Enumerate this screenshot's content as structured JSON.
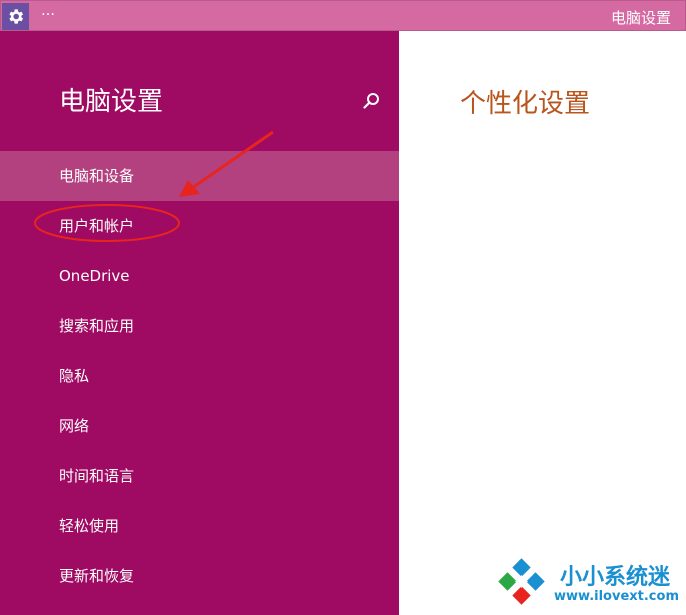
{
  "titlebar": {
    "dots": "…",
    "title": "电脑设置"
  },
  "sidebar": {
    "title": "电脑设置",
    "items": [
      {
        "label": "电脑和设备",
        "selected": true
      },
      {
        "label": "用户和帐户"
      },
      {
        "label": "OneDrive"
      },
      {
        "label": "搜索和应用"
      },
      {
        "label": "隐私"
      },
      {
        "label": "网络"
      },
      {
        "label": "时间和语言"
      },
      {
        "label": "轻松使用"
      },
      {
        "label": "更新和恢复"
      }
    ]
  },
  "main": {
    "title": "个性化设置"
  },
  "watermark": {
    "name": "小小系统迷",
    "url": "www.ilovext.com"
  },
  "colors": {
    "sidebar_bg": "#9f0a62",
    "selected_bg": "#b3407f",
    "titlebar_bg": "#d56aa3",
    "annotation_red": "#e8241f",
    "heading_accent": "#b8541d"
  }
}
